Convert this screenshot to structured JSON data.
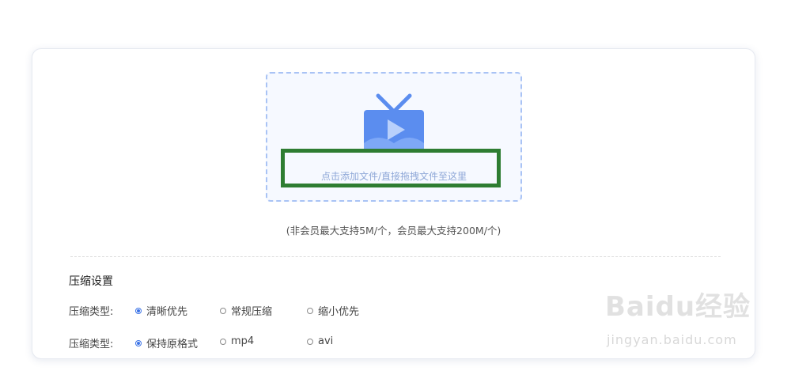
{
  "upload": {
    "prompt": "点击添加文件/直接拖拽文件至这里",
    "limit_note": "(非会员最大支持5M/个，会员最大支持200M/个)"
  },
  "settings": {
    "title": "压缩设置",
    "rows": [
      {
        "label": "压缩类型:",
        "options": [
          {
            "label": "清晰优先",
            "checked": true
          },
          {
            "label": "常规压缩",
            "checked": false
          },
          {
            "label": "缩小优先",
            "checked": false
          }
        ]
      },
      {
        "label": "压缩类型:",
        "options": [
          {
            "label": "保持原格式",
            "checked": true
          },
          {
            "label": "mp4",
            "checked": false
          },
          {
            "label": "avi",
            "checked": false
          }
        ]
      }
    ]
  },
  "watermark": {
    "brand": "Baidu经验",
    "url": "jingyan.baidu.com"
  },
  "colors": {
    "accent": "#3b73e6",
    "dropzone_border": "#a9c3f5",
    "dropzone_bg": "#f6f9ff",
    "highlight": "#2e7d32",
    "tv_icon": "#5b8def"
  },
  "icons": {
    "upload_icon": "tv-play-icon"
  }
}
